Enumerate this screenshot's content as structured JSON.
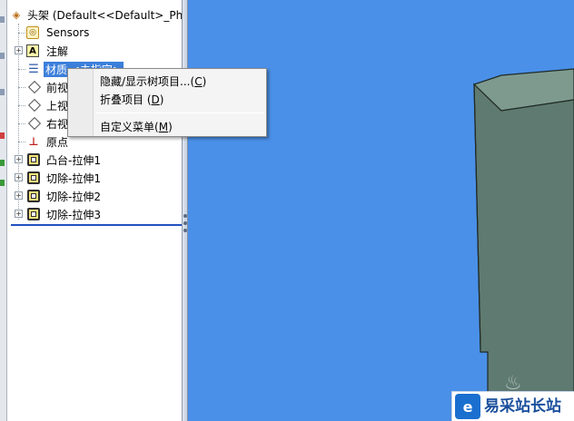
{
  "tree": {
    "root": "头架 (Default<<Default>_Pho",
    "items": [
      {
        "label": "Sensors",
        "icon": "sensor-icon"
      },
      {
        "label": "注解",
        "icon": "annotation-icon"
      },
      {
        "label": "材质 <未指定>",
        "icon": "material-icon"
      },
      {
        "label": "前视",
        "icon": "plane-icon"
      },
      {
        "label": "上视",
        "icon": "plane-icon"
      },
      {
        "label": "右视",
        "icon": "plane-icon"
      },
      {
        "label": "原点",
        "icon": "origin-icon"
      },
      {
        "label": "凸台-拉伸1",
        "icon": "boss-extrude-icon"
      },
      {
        "label": "切除-拉伸1",
        "icon": "cut-extrude-icon"
      },
      {
        "label": "切除-拉伸2",
        "icon": "cut-extrude-icon"
      },
      {
        "label": "切除-拉伸3",
        "icon": "cut-extrude-icon"
      }
    ]
  },
  "context_menu": {
    "items": [
      {
        "label": "隐藏/显示树项目...",
        "key": "C"
      },
      {
        "label": "折叠项目",
        "key": "D"
      },
      {
        "label": "自定义菜单",
        "key": "M"
      }
    ]
  },
  "watermark": {
    "brand": "易采站长站"
  },
  "colors": {
    "viewport": "#4a90e8",
    "model_front": "#5f7a70",
    "model_top": "#7e9a8f",
    "selection": "#3b7fdb"
  }
}
